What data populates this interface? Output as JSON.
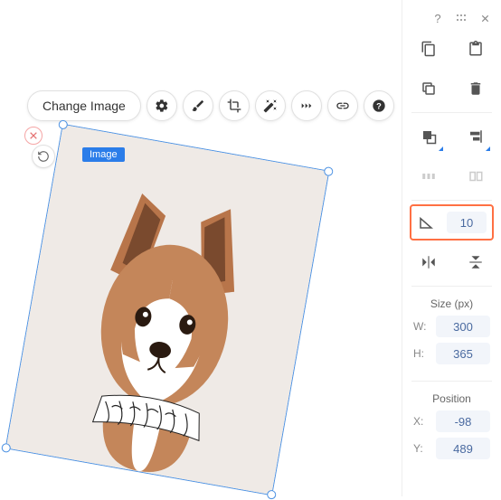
{
  "toolbar": {
    "change_image_label": "Change Image"
  },
  "selection": {
    "label": "Image"
  },
  "rotation": {
    "value": "10"
  },
  "size": {
    "title": "Size (px)",
    "w_label": "W:",
    "w_value": "300",
    "h_label": "H:",
    "h_value": "365"
  },
  "position": {
    "title": "Position",
    "x_label": "X:",
    "x_value": "-98",
    "y_label": "Y:",
    "y_value": "489"
  }
}
